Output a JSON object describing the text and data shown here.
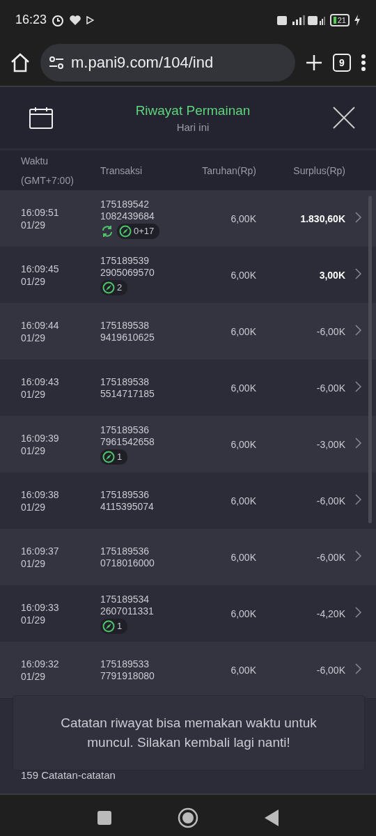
{
  "status_bar": {
    "time": "16:23",
    "battery": "21"
  },
  "browser": {
    "url": "m.pani9.com/104/ind",
    "tab_count": "9"
  },
  "header": {
    "title": "Riwayat Permainan",
    "subtitle": "Hari ini"
  },
  "table": {
    "columns": [
      {
        "label": "Waktu",
        "sub": "(GMT+7:00)"
      },
      {
        "label": "Transaksi"
      },
      {
        "label": "Taruhan(Rp)"
      },
      {
        "label": "Surplus(Rp)"
      }
    ],
    "rows": [
      {
        "time": "16:09:51",
        "date": "01/29",
        "id_1": "175189542",
        "id_2": "1082439684",
        "bet": "6,00K",
        "surplus": "1.830,60K",
        "positive": true,
        "respin_badge": {
          "label": "0+17"
        }
      },
      {
        "time": "16:09:45",
        "date": "01/29",
        "id_1": "175189539",
        "id_2": "2905069570",
        "bet": "6,00K",
        "surplus": "3,00K",
        "positive": true,
        "badge": {
          "label": "2"
        }
      },
      {
        "time": "16:09:44",
        "date": "01/29",
        "id_1": "175189538",
        "id_2": "9419610625",
        "bet": "6,00K",
        "surplus": "-6,00K",
        "positive": false
      },
      {
        "time": "16:09:43",
        "date": "01/29",
        "id_1": "175189538",
        "id_2": "5514717185",
        "bet": "6,00K",
        "surplus": "-6,00K",
        "positive": false
      },
      {
        "time": "16:09:39",
        "date": "01/29",
        "id_1": "175189536",
        "id_2": "7961542658",
        "bet": "6,00K",
        "surplus": "-3,00K",
        "positive": false,
        "badge": {
          "label": "1"
        }
      },
      {
        "time": "16:09:38",
        "date": "01/29",
        "id_1": "175189536",
        "id_2": "4115395074",
        "bet": "6,00K",
        "surplus": "-6,00K",
        "positive": false
      },
      {
        "time": "16:09:37",
        "date": "01/29",
        "id_1": "175189536",
        "id_2": "0718016000",
        "bet": "6,00K",
        "surplus": "-6,00K",
        "positive": false
      },
      {
        "time": "16:09:33",
        "date": "01/29",
        "id_1": "175189534",
        "id_2": "2607011331",
        "bet": "6,00K",
        "surplus": "-4,20K",
        "positive": false,
        "badge": {
          "label": "1"
        }
      },
      {
        "time": "16:09:32",
        "date": "01/29",
        "id_1": "175189533",
        "id_2": "7791918080",
        "bet": "6,00K",
        "surplus": "-6,00K",
        "positive": false
      }
    ]
  },
  "footer": {
    "count": "159 Catatan-catatan"
  },
  "toast": {
    "message": "Catatan riwayat bisa memakan waktu untuk muncul. Silakan kembali lagi nanti!"
  }
}
